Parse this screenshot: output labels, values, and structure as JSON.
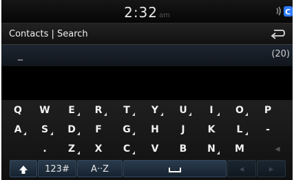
{
  "status": {
    "time": "2:32",
    "ampm": "am",
    "status_icon": "connectivity-icon",
    "accent_color": "#2f7bff"
  },
  "header": {
    "title": "Contacts | Search",
    "back_icon": "back-arrow-icon"
  },
  "search": {
    "cursor": "_",
    "count": "(20)"
  },
  "keyboard": {
    "row1": [
      {
        "label": "Q",
        "accent": false
      },
      {
        "label": "W",
        "accent": false
      },
      {
        "label": "E",
        "accent": true
      },
      {
        "label": "R",
        "accent": true
      },
      {
        "label": "T",
        "accent": true
      },
      {
        "label": "Y",
        "accent": true
      },
      {
        "label": "U",
        "accent": true
      },
      {
        "label": "I",
        "accent": true
      },
      {
        "label": "O",
        "accent": true
      },
      {
        "label": "P",
        "accent": false
      }
    ],
    "row2": [
      {
        "label": "A",
        "accent": true
      },
      {
        "label": "S",
        "accent": true
      },
      {
        "label": "D",
        "accent": true
      },
      {
        "label": "F",
        "accent": false
      },
      {
        "label": "G",
        "accent": true
      },
      {
        "label": "H",
        "accent": false
      },
      {
        "label": "J",
        "accent": false
      },
      {
        "label": "K",
        "accent": false
      },
      {
        "label": "L",
        "accent": true
      },
      {
        "label": "-",
        "accent": false
      }
    ],
    "row3": [
      {
        "label": ".",
        "accent": false
      },
      {
        "label": "Z",
        "accent": true
      },
      {
        "label": "X",
        "accent": false
      },
      {
        "label": "C",
        "accent": true
      },
      {
        "label": "V",
        "accent": false
      },
      {
        "label": "B",
        "accent": false
      },
      {
        "label": "N",
        "accent": true
      },
      {
        "label": "M",
        "accent": false
      }
    ],
    "functions": {
      "shift_icon": "shift-arrow-icon",
      "numbers": "123#",
      "alpha": "A··Z",
      "space_icon": "space-bar-icon"
    }
  }
}
